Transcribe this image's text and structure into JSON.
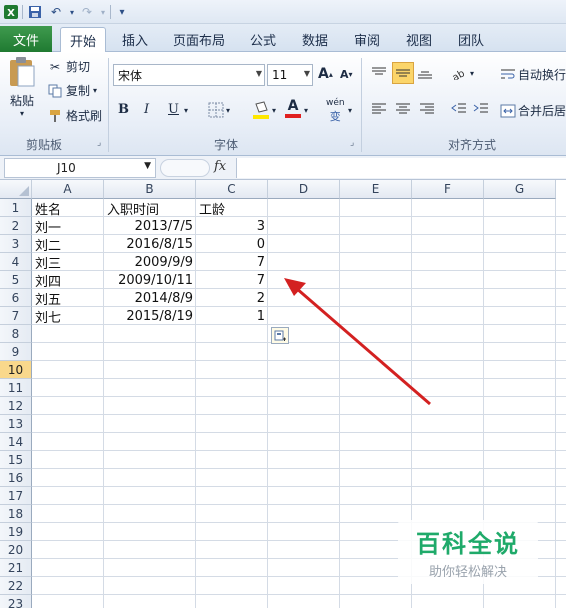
{
  "tabs": [
    "文件",
    "开始",
    "插入",
    "页面布局",
    "公式",
    "数据",
    "审阅",
    "视图",
    "团队"
  ],
  "clipboard": {
    "paste": "粘贴",
    "cut": "剪切",
    "copy": "复制",
    "format_painter": "格式刷",
    "group": "剪贴板"
  },
  "font": {
    "name": "宋体",
    "size": "11",
    "bold": "B",
    "italic": "I",
    "underline": "U",
    "phonetic": "wén",
    "group": "字体"
  },
  "alignment": {
    "wrap_text": "自动换行",
    "merge_center": "合并后居",
    "group": "对齐方式"
  },
  "formula_bar": {
    "name_box": "J10",
    "fx": "fx",
    "content": ""
  },
  "sheet": {
    "columns": [
      "A",
      "B",
      "C",
      "D",
      "E",
      "F",
      "G"
    ],
    "rows": [
      "1",
      "2",
      "3",
      "4",
      "5",
      "6",
      "7",
      "8",
      "9",
      "10",
      "11",
      "12",
      "13",
      "14",
      "15",
      "16",
      "17",
      "18",
      "19",
      "20",
      "21",
      "22",
      "23"
    ],
    "selected_row": "10",
    "cells": [
      [
        "姓名",
        "入职时间",
        "工龄"
      ],
      [
        "刘一",
        "2013/7/5",
        "3"
      ],
      [
        "刘二",
        "2016/8/15",
        "0"
      ],
      [
        "刘三",
        "2009/9/9",
        "7"
      ],
      [
        "刘四",
        "2009/10/11",
        "7"
      ],
      [
        "刘五",
        "2014/8/9",
        "2"
      ],
      [
        "刘七",
        "2015/8/19",
        "1"
      ]
    ]
  },
  "watermark": {
    "title": "百科全说",
    "subtitle": "助你轻松解决"
  },
  "colors": {
    "file_tab": "#1f7a31",
    "arrow": "#d32121",
    "selected_row_header": "#f9d88c"
  }
}
